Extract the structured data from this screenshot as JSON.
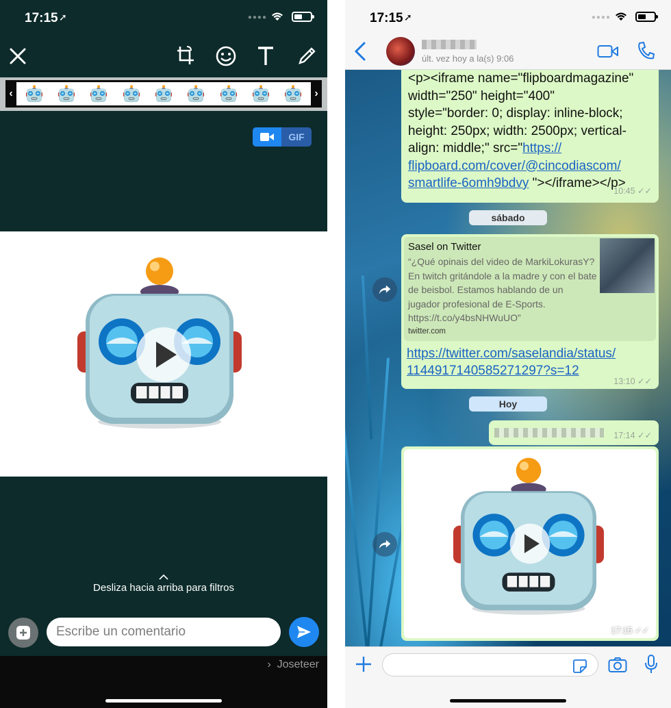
{
  "left": {
    "status": {
      "time": "17:15"
    },
    "toolbar": {
      "close": "✕",
      "crop": "crop",
      "emoji": "emoji",
      "text": "T",
      "draw": "pencil"
    },
    "toggle": {
      "gif_label": "GIF"
    },
    "hint": "Desliza hacia arriba para filtros",
    "comment_placeholder": "Escribe un comentario",
    "recipient": "Joseteer"
  },
  "right": {
    "status": {
      "time": "17:15"
    },
    "header": {
      "last_seen": "últ. vez hoy a la(s) 9:06"
    },
    "messages": [
      {
        "text_lines": [
          "<p><iframe name=\"flipboardmagazine\"",
          "width=\"250\" height=\"400\"",
          "style=\"border: 0; display: inline-block;",
          "height: 250px; width: 2500px; vertical-",
          "align: middle;\" src=\""
        ],
        "link_lines": [
          "https://",
          "flipboard.com/cover/@cincodiascom/",
          "smartlife-6omh9bdvy"
        ],
        "tail": " \"></iframe></p>",
        "time": "10:45"
      },
      {
        "preview_title": "Sasel on Twitter",
        "preview_desc": "“¿Qué opinais del video de MarkiLokurasY? En twitch gritándole a la madre y con el bate de beisbol. Estamos hablando de un jugador profesional de E-Sports. https://t.co/y4bsNHWuUO”",
        "preview_domain": "twitter.com",
        "url_lines": [
          "https://twitter.com/saselandia/status/",
          "1144917140585271297?s=12"
        ],
        "time": "13:10"
      },
      {
        "time": "17:14"
      },
      {
        "time": "17:15"
      }
    ],
    "date_chips": [
      "sábado",
      "Hoy"
    ]
  },
  "colors": {
    "whatsapp_blue": "#1f87f0",
    "bubble_green": "#dcf8c6",
    "editor_bg": "#0c2b2a"
  }
}
